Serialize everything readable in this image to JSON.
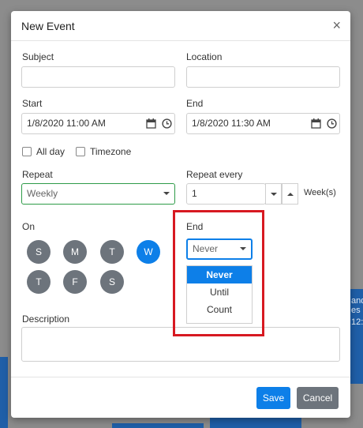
{
  "dialog": {
    "title": "New Event",
    "close_glyph": "×"
  },
  "fields": {
    "subject": {
      "label": "Subject",
      "value": ""
    },
    "location": {
      "label": "Location",
      "value": ""
    },
    "start": {
      "label": "Start",
      "value": "1/8/2020 11:00 AM"
    },
    "end": {
      "label": "End",
      "value": "1/8/2020 11:30 AM"
    },
    "all_day": {
      "label": "All day",
      "checked": false
    },
    "timezone": {
      "label": "Timezone",
      "checked": false
    },
    "repeat": {
      "label": "Repeat",
      "value": "Weekly"
    },
    "repeat_every": {
      "label": "Repeat every",
      "value": "1",
      "unit": "Week(s)"
    },
    "on": {
      "label": "On",
      "days": [
        "S",
        "M",
        "T",
        "W",
        "T",
        "F",
        "S"
      ],
      "active_index": 3
    },
    "end_repeat": {
      "label": "End",
      "value": "Never",
      "options": [
        "Never",
        "Until",
        "Count"
      ],
      "selected_index": 0
    },
    "description": {
      "label": "Description",
      "value": ""
    }
  },
  "buttons": {
    "save": "Save",
    "cancel": "Cancel"
  },
  "background": {
    "fragments": [
      "and",
      "es",
      "12:"
    ]
  },
  "colors": {
    "accent": "#0d7fe8",
    "highlight": "#d71921",
    "day_inactive": "#6d747c",
    "repeat_border": "#2e9b48"
  }
}
